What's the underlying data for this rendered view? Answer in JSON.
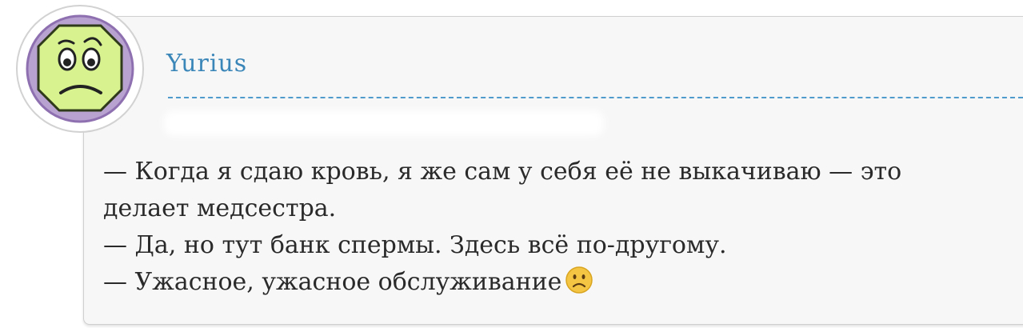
{
  "comment": {
    "author": "Yurius",
    "lines": [
      "— Когда я сдаю кровь, я же сам у себя её не выкачиваю — это",
      "делает медсестра.",
      "— Да, но тут банк спермы. Здесь всё по-другому.",
      "— Ужасное, ужасное обслуживание"
    ],
    "emoji": "sad-face-emoji"
  },
  "colors": {
    "author_link": "#3b86b8",
    "divider": "#4f9bcb",
    "card_background": "#f7f7f7",
    "avatar_face": "#d7f28f",
    "avatar_border": "#9b7fb8",
    "emoji_face": "#f4c542"
  }
}
